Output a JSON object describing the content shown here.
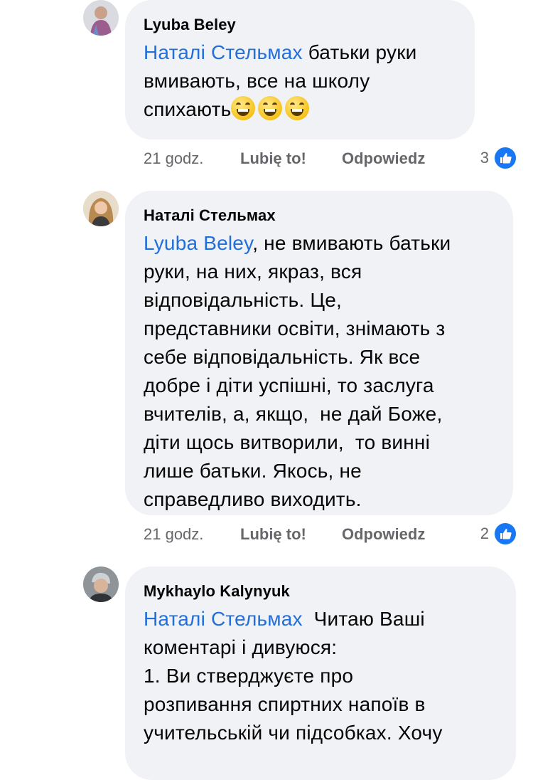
{
  "comments": [
    {
      "author": "Lyuba Beley",
      "mention": "Наталі Стельмах",
      "lines": [
        " батьки руки",
        "вмивають, все на школу",
        "спихають"
      ],
      "emoji_count": 3,
      "emoji": "grinning-face-icon",
      "time": "21 godz.",
      "like_label": "Lubię to!",
      "reply_label": "Odpowiedz",
      "reaction_count": "3",
      "reaction_icon": "like-thumb-icon"
    },
    {
      "author": "Наталі Стельмах",
      "mention": "Lyuba Beley",
      "lines": [
        ", не вмивають батьки",
        "руки, на них, якраз, вся",
        "відповідальність. Це,",
        "представники освіти, знімають з",
        "себе відповідальність. Як все",
        "добре і діти успішні, то заслуга",
        "вчителів, а, якщо,  не дай Боже,",
        "діти щось витворили,  то винні",
        "лише батьки. Якось, не",
        "справедливо виходить."
      ],
      "time": "21 godz.",
      "like_label": "Lubię to!",
      "reply_label": "Odpowiedz",
      "reaction_count": "2",
      "reaction_icon": "like-thumb-icon"
    },
    {
      "author": "Mykhaylo Kalynyuk",
      "mention": "Наталі Стельмах",
      "lines": [
        "  Читаю Ваші",
        "коментарі і дивуюся:",
        "1. Ви стверджуєте про",
        "розпивання спиртних напоїв в",
        "учительській чи підсобках. Хочу"
      ]
    }
  ],
  "colors": {
    "bubble": "#f0f2f5",
    "mention": "#216fdb",
    "meta": "#65676b",
    "like_badge": "#1877f2"
  }
}
